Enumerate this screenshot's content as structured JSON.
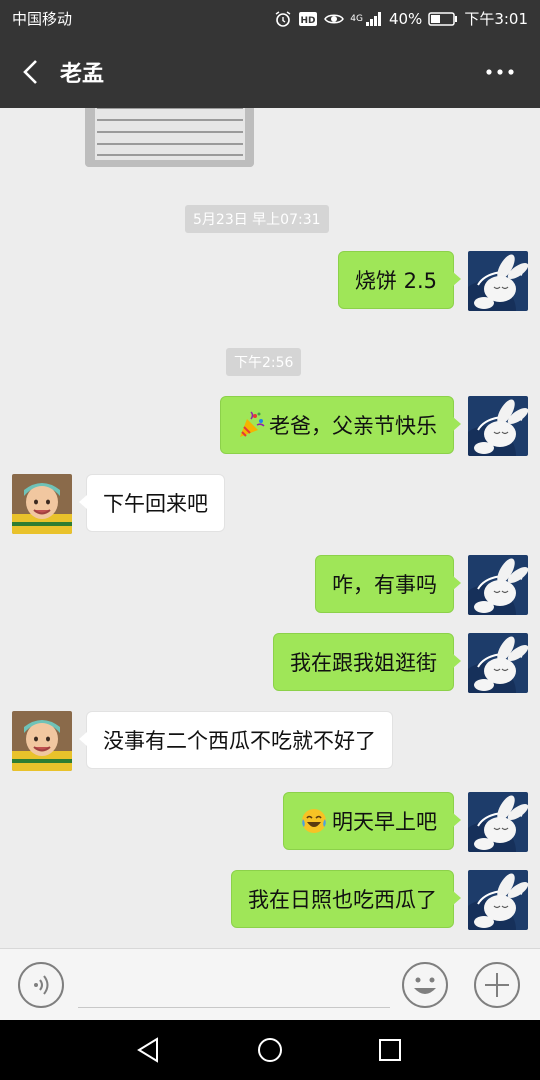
{
  "status": {
    "carrier": "中国移动",
    "network": "4G",
    "battery": "40%",
    "time": "下午3:01",
    "icons": [
      "alarm-icon",
      "hd-icon",
      "eye-icon",
      "signal-icon",
      "battery-icon"
    ]
  },
  "header": {
    "title": "老孟",
    "back_icon": "chevron-left-icon",
    "more_icon": "more-icon"
  },
  "messages": {
    "ts1": "5月23日 早上07:31",
    "m1": "烧饼 2.5",
    "ts2": "下午2:56",
    "m2": "老爸，父亲节快乐",
    "m3": "下午回来吧",
    "m4": "咋，有事吗",
    "m5": "我在跟我姐逛街",
    "m6": "没事有二个西瓜不吃就不好了",
    "m7": "明天早上吧",
    "m8": "我在日照也吃西瓜了"
  },
  "input": {
    "voice_icon": "voice-icon",
    "emoji_icon": "smiley-icon",
    "plus_icon": "plus-icon"
  },
  "colors": {
    "bar": "#353535",
    "bubble_me": "#9fe658",
    "background": "#ededed"
  }
}
